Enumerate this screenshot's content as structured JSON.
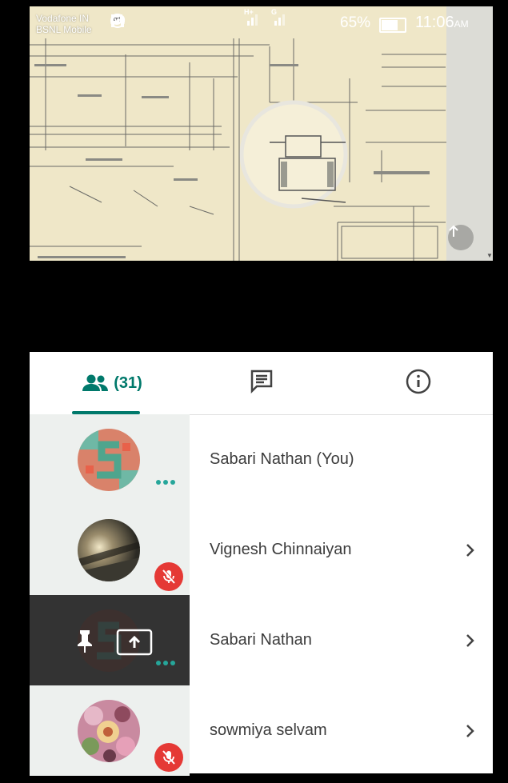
{
  "status_bar": {
    "carrier_1": "Vodafone IN",
    "carrier_2": "BSNL Mobile",
    "battery": "65%",
    "battery_level": 0.65,
    "time": "11:06",
    "time_suffix": "AM",
    "network_1": "H+",
    "network_2": "G",
    "icons": [
      "chat-bubble-icon",
      "hangouts-icon",
      "whatsapp-icon",
      "hotspot-icon",
      "headphones-icon",
      "signal-icon",
      "signal-icon"
    ]
  },
  "shared_screen": {
    "content": "engineering-drawing",
    "fab_icon": "arrow-up-icon"
  },
  "tabs": {
    "people_count": "(31)",
    "people_icon": "people-icon",
    "chat_icon": "chat-icon",
    "info_icon": "info-icon",
    "active": "people"
  },
  "participants": [
    {
      "name": "Sabari Nathan (You)",
      "status": "speaking-dots",
      "chevron": false,
      "avatar": "letter-s-avatar"
    },
    {
      "name": "Vignesh Chinnaiyan",
      "status": "muted",
      "chevron": true,
      "avatar": "photo-avatar"
    },
    {
      "name": "Sabari Nathan",
      "status": "speaking-dots",
      "chevron": true,
      "avatar": "letter-s-avatar",
      "highlighted": true,
      "actions": [
        "pin-icon",
        "present-icon"
      ]
    },
    {
      "name": "sowmiya selvam",
      "status": "muted",
      "chevron": true,
      "avatar": "flowers-avatar"
    }
  ],
  "colors": {
    "accent": "#00796b",
    "mute_badge": "#e53935",
    "dots": "#26a69a",
    "highlight_row": "#333333"
  }
}
